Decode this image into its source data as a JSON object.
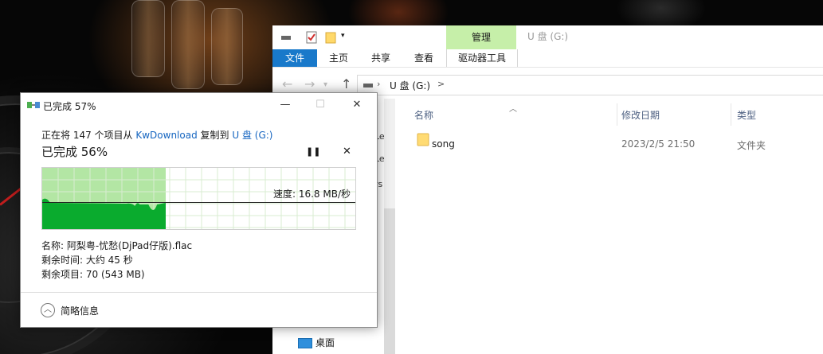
{
  "explorer": {
    "manage_tab": "管理",
    "window_title": "U 盘 (G:)",
    "ribbon_tabs": [
      "文件",
      "主页",
      "共享",
      "查看",
      "驱动器工具"
    ],
    "nav_back": "←",
    "nav_forward": "→",
    "nav_up": "↑",
    "address": "U 盘 (G:)",
    "address_chevron": ">",
    "nav_partial": [
      "Le",
      "Le",
      "rs"
    ],
    "nav_desktop": "桌面",
    "columns": [
      "名称",
      "修改日期",
      "类型"
    ],
    "files": [
      {
        "name": "song",
        "modified": "2023/2/5 21:50",
        "type": "文件夹"
      }
    ]
  },
  "dialog": {
    "title": "已完成 57%",
    "line_prefix": "正在将 147 个项目从 ",
    "source": "KwDownload",
    "line_mid": " 复制到 ",
    "destination": "U 盘 (G:)",
    "percent_label": "已完成 56%",
    "progress": 0.57,
    "speed_label": "速度: 16.8 MB/秒",
    "name_line": "名称: 阿梨粤-忧愁(DjPad仔版).flac",
    "time_line": "剩余时间: 大约 45 秒",
    "items_line": "剩余项目: 70 (543 MB)",
    "details_toggle": "简略信息",
    "pause_glyph": "❚❚",
    "stop_glyph": "✕",
    "minimize_glyph": "—",
    "maximize_glyph": "☐",
    "close_glyph": "✕",
    "details_glyph": "︿"
  },
  "colors": {
    "accent": "#1979ca",
    "manage_tab": "#c6efa9",
    "graph_fill": "#b3e6a4",
    "graph_area": "#0aab2e",
    "link": "#1565c0"
  }
}
